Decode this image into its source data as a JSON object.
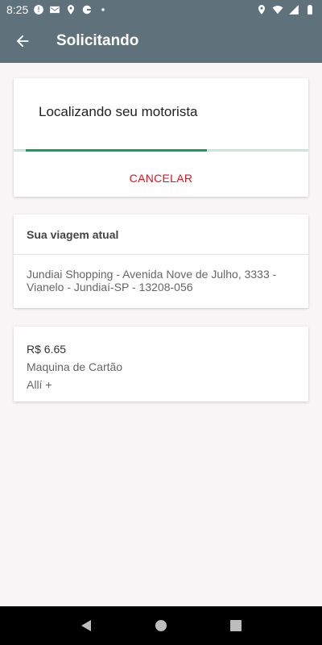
{
  "status_bar": {
    "time": "8:25",
    "left_icons": [
      "sync-icon",
      "gmail-icon",
      "location-icon",
      "google-icon",
      "dot-icon"
    ],
    "right_icons": [
      "location-icon",
      "wifi-icon",
      "signal-icon",
      "battery-icon"
    ]
  },
  "app_bar": {
    "title": "Solicitando",
    "back_icon": "arrow-back-icon"
  },
  "status_card": {
    "title": "Localizando seu motorista",
    "progress": 0.64,
    "cancel_label": "CANCELAR",
    "progress_color": "#16a055",
    "cancel_color": "#e4121b"
  },
  "trip_card": {
    "header": "Sua viagem atual",
    "address": "Jundiai Shopping - Avenida Nove de Julho, 3333 - Vianelo - Jundiaí-SP - 13208-056"
  },
  "payment_card": {
    "price": "R$ 6.65",
    "method": "Maquina de Cartão",
    "extra": "Allí +"
  },
  "nav_bar": {
    "icons": [
      "back-triangle-icon",
      "home-circle-icon",
      "recents-square-icon"
    ]
  },
  "colors": {
    "app_bar": "#5f717b",
    "background": "#f7f5f6"
  }
}
